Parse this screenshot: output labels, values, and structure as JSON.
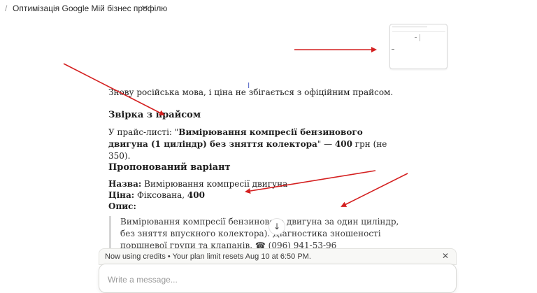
{
  "header": {
    "separator": "/",
    "title": "Оптимізація Google Мій бізнес профілю"
  },
  "content": {
    "intro": "Знову російська мова, і ціна не збігається з офіційним прайсом.",
    "section1_title": "Звірка з прайсом",
    "price_prefix": "У прайс-листі: \"",
    "price_item": "Вимірювання компресії бензинового двигуна (1 циліндр) без зняття колектора",
    "price_mid": "\" — ",
    "price_value": "400",
    "price_suffix": " грн (не 350).",
    "section2_title": "Пропонований варіант",
    "name_label": "Назва:",
    "name_value": " Вимірювання компресії двигуна",
    "price_label": "Ціна:",
    "price_type": " Фіксована, ",
    "price_number": "400",
    "desc_label": "Опис:",
    "quote_text": "Вимірювання компресії бензинового двигуна за один циліндр, без зняття впускного колектора). Діагностика зношеності поршневої групи та клапанів. ☎ (096) 941-53-96"
  },
  "credits": {
    "text": "Now using credits • Your plan limit resets Aug 10 at 6:50 PM.",
    "close": "✕"
  },
  "composer": {
    "placeholder": "Write a message..."
  },
  "icons": {
    "scroll_down": "↓",
    "cursor": "I"
  },
  "colors": {
    "annotation_arrow": "#d42020"
  }
}
